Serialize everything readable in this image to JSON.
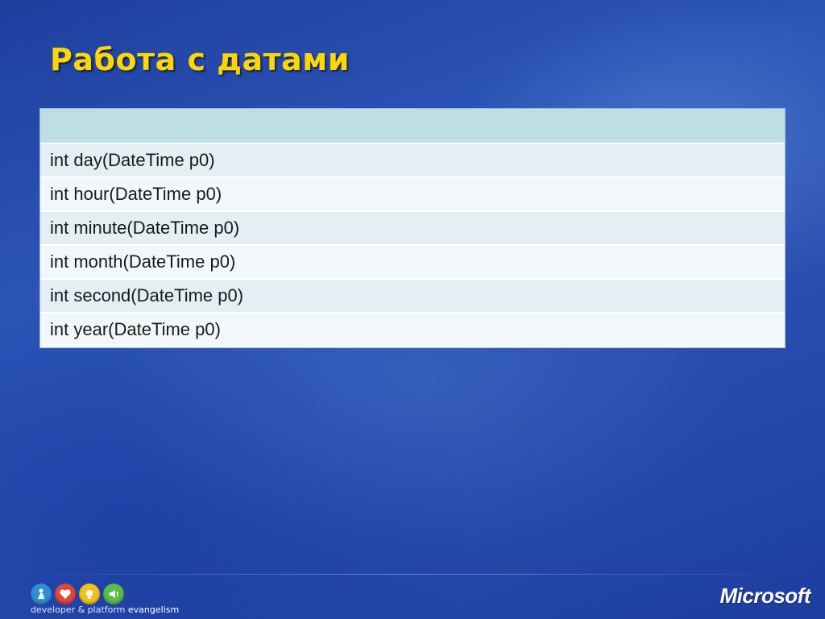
{
  "slide": {
    "title": "Работа с датами"
  },
  "table": {
    "header": "",
    "rows": [
      "int day(DateTime p0)",
      "int hour(DateTime p0)",
      "int minute(DateTime p0)",
      "int month(DateTime p0)",
      "int second(DateTime p0)",
      "int year(DateTime p0)"
    ]
  },
  "footer": {
    "text_part1": "developer & platform",
    "text_part2": " evangelism",
    "icons": [
      "blue-figure-icon",
      "red-heart-icon",
      "yellow-lightbulb-icon",
      "green-speaker-icon"
    ],
    "icon_colors": [
      "#2f8fd6",
      "#e2463b",
      "#f2c21a",
      "#5dbb46"
    ],
    "brand": "Microsoft"
  }
}
